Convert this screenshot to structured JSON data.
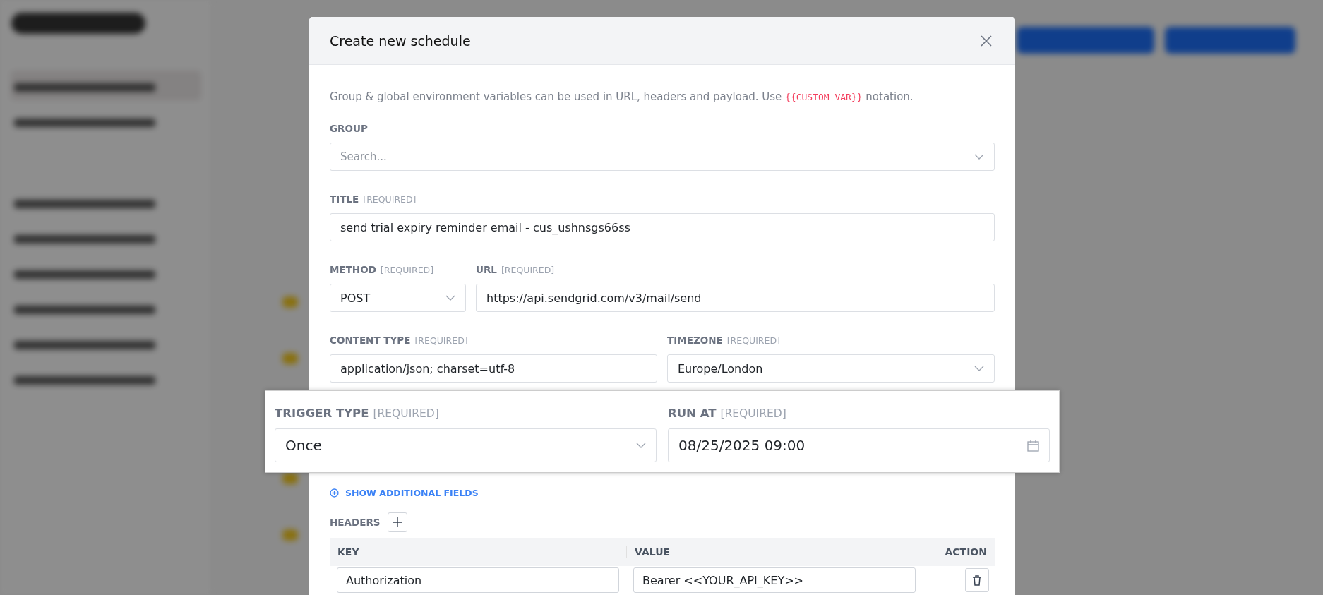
{
  "modal": {
    "title": "Create new schedule",
    "info": {
      "before": "Group & global environment variables can be used in URL, headers and payload. Use ",
      "code": "{{CUSTOM_VAR}}",
      "after": " notation."
    },
    "rows": [
      {
        "fields": [
          {
            "label": "GROUP",
            "kind": "select",
            "placeholder": "Search..."
          }
        ]
      },
      {
        "fields": [
          {
            "label": "TITLE",
            "required": "[REQUIRED]",
            "kind": "text",
            "value": "send trial expiry reminder email - cus_ushnsgs66ss"
          }
        ]
      },
      {
        "fields": [
          {
            "label": "METHOD",
            "required": "[REQUIRED]",
            "kind": "select",
            "value": "POST"
          },
          {
            "label": "URL",
            "required": "[REQUIRED]",
            "kind": "text",
            "value": "https://api.sendgrid.com/v3/mail/send"
          }
        ]
      },
      {
        "fields": [
          {
            "label": "CONTENT TYPE",
            "required": "[REQUIRED]",
            "kind": "text",
            "value": "application/json; charset=utf-8"
          },
          {
            "label": "TIMEZONE",
            "required": "[REQUIRED]",
            "kind": "select",
            "value": "Europe/London"
          }
        ]
      }
    ],
    "spotlight": {
      "fields": [
        {
          "label": "TRIGGER TYPE",
          "required": "[REQUIRED]",
          "kind": "select",
          "value": "Once"
        },
        {
          "label": "RUN AT",
          "required": "[REQUIRED]",
          "kind": "datetime",
          "value": "08/25/2025 09:00"
        }
      ]
    },
    "additional_fields_link": "SHOW ADDITIONAL FIELDS",
    "headers": {
      "label": "HEADERS",
      "columns": [
        "KEY",
        "VALUE",
        "ACTION"
      ],
      "rows": [
        {
          "key": "Authorization",
          "value": "Bearer <<YOUR_API_KEY>>"
        }
      ]
    }
  }
}
